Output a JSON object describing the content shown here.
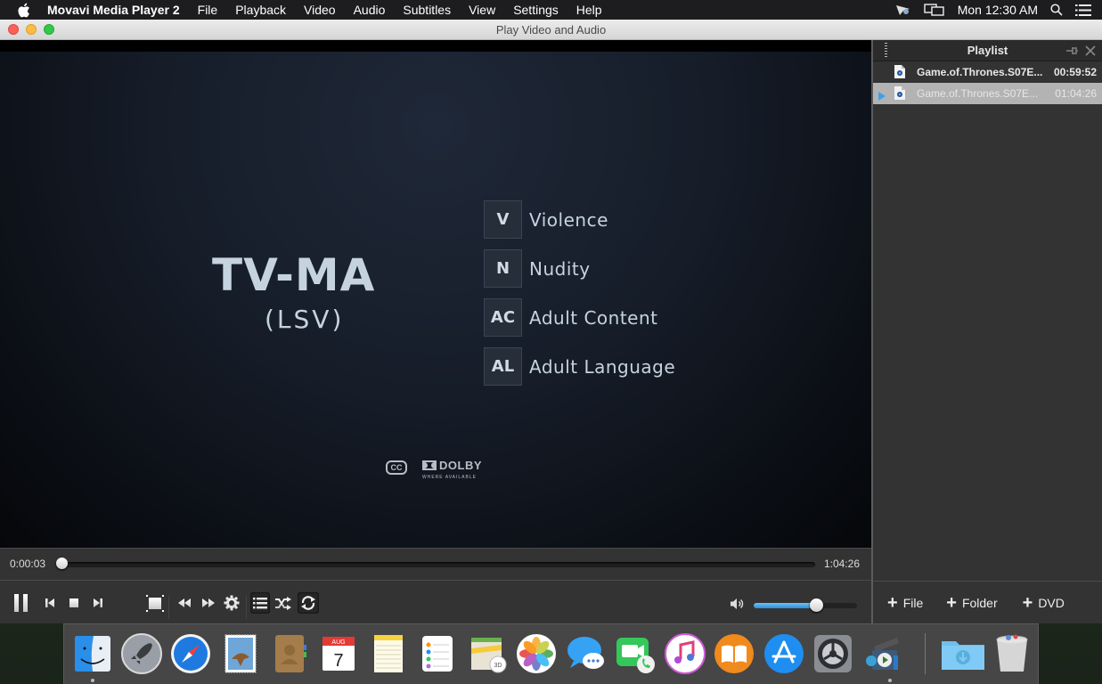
{
  "menubar": {
    "app_name": "Movavi Media Player 2",
    "menus": [
      "File",
      "Playback",
      "Video",
      "Audio",
      "Subtitles",
      "View",
      "Settings",
      "Help"
    ],
    "status_icons": [
      "location-cast-icon",
      "airplay-display-icon"
    ],
    "clock": "Mon 12:30 AM",
    "right_icons": [
      "spotlight-search-icon",
      "notification-center-icon"
    ]
  },
  "window": {
    "title": "Play Video and Audio"
  },
  "video": {
    "rating": "TV-MA",
    "rating_sub": "(LSV)",
    "descriptors": [
      {
        "code": "V",
        "label": "Violence"
      },
      {
        "code": "N",
        "label": "Nudity"
      },
      {
        "code": "AC",
        "label": "Adult Content"
      },
      {
        "code": "AL",
        "label": "Adult Language"
      }
    ],
    "cc_label": "CC",
    "dolby_label": "DOLBY",
    "dolby_sub": "WHERE AVAILABLE"
  },
  "controls": {
    "current_time": "0:00:03",
    "total_time": "1:04:26",
    "progress_fraction": 0.0008,
    "volume_fraction": 0.6,
    "playlist_toggle_on": true,
    "repeat_toggle_on": true
  },
  "playlist": {
    "title": "Playlist",
    "items": [
      {
        "name": "Game.of.Thrones.S07E...",
        "duration": "00:59:52",
        "active": false
      },
      {
        "name": "Game.of.Thrones.S07E...",
        "duration": "01:04:26",
        "active": true
      }
    ],
    "add_buttons": [
      "File",
      "Folder",
      "DVD"
    ]
  },
  "dock": {
    "apps": [
      "Finder",
      "Launchpad",
      "Safari",
      "Mail",
      "Contacts",
      "Calendar",
      "Notes",
      "Reminders",
      "Maps",
      "Photos",
      "Messages",
      "FaceTime",
      "iTunes",
      "iBooks",
      "App Store",
      "System Preferences",
      "Movavi Media Player"
    ],
    "calendar_month": "AUG",
    "calendar_day": "7",
    "others": [
      "Downloads",
      "Trash"
    ]
  }
}
